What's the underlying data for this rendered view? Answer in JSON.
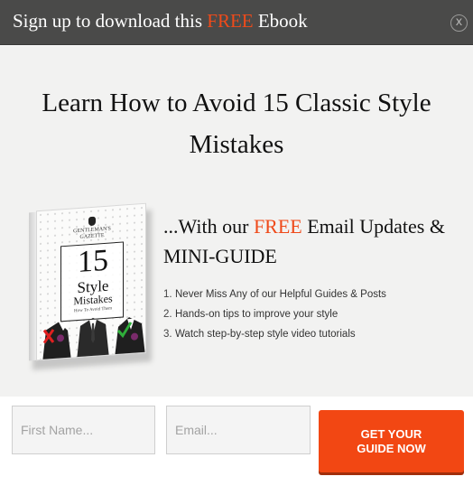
{
  "header": {
    "title_prefix": "Sign up to download this ",
    "title_accent": "FREE",
    "title_suffix": " Ebook",
    "close_glyph": "x"
  },
  "headline": "Learn How to Avoid 15 Classic Style Mistakes",
  "book": {
    "brand_line1": "GENTLEMAN'S",
    "brand_line2": "GAZETTE",
    "number": "15",
    "word1": "Style",
    "word2": "Mistakes",
    "subtitle": "How To Avoid Them"
  },
  "lead": {
    "prefix": "...With our ",
    "accent": "FREE",
    "suffix": " Email Updates & MINI-GUIDE"
  },
  "bullets": [
    {
      "num": "1.",
      "text": "Never Miss Any of our Helpful Guides & Posts"
    },
    {
      "num": "2.",
      "text": "Hands-on tips to improve your style"
    },
    {
      "num": "3.",
      "text": "Watch step-by-step style video tutorials"
    }
  ],
  "form": {
    "first_name_placeholder": "First Name...",
    "email_placeholder": "Email...",
    "submit_label": "GET YOUR GUIDE NOW"
  },
  "colors": {
    "accent": "#ef4a1a",
    "header_bg": "#4a4a49",
    "button_bg": "#f24713"
  }
}
